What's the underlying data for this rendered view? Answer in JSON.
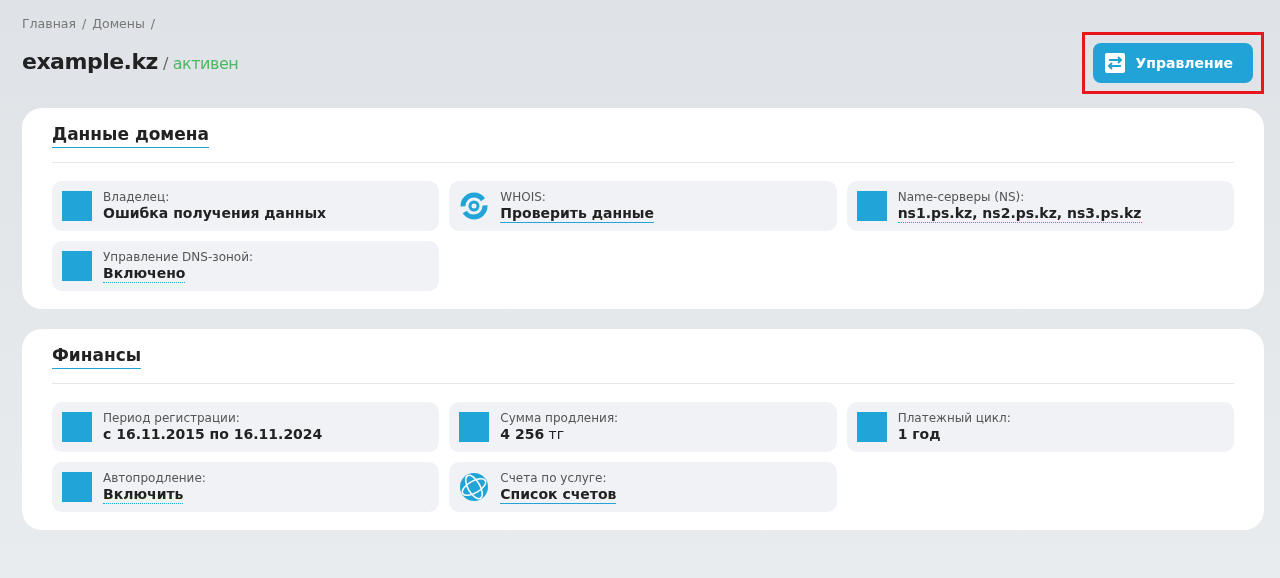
{
  "breadcrumbs": [
    {
      "label": "Главная",
      "separator": "/"
    },
    {
      "label": "Домены",
      "separator": "/"
    }
  ],
  "title": {
    "domain": "example.kz",
    "separator": "/",
    "status": "активен"
  },
  "manage_button": {
    "label": "Управление",
    "highlighted": true
  },
  "sections": [
    {
      "title": "Данные домена",
      "items": [
        {
          "kind": "field",
          "label": "Владелец:",
          "value": "Ошибка получения данных"
        },
        {
          "kind": "whois",
          "label": "WHOIS:",
          "value": "Проверить данные"
        },
        {
          "kind": "setting",
          "label": "Name-серверы (NS):",
          "value": "ns1.ps.kz, ns2.ps.kz, ns3.ps.kz"
        },
        {
          "kind": "setting",
          "label": "Управление DNS-зоной:",
          "value": "Включено"
        }
      ]
    },
    {
      "title": "Финансы",
      "items": [
        {
          "kind": "field",
          "label": "Период регистрации:",
          "value": "с 16.11.2015 по 16.11.2024"
        },
        {
          "kind": "field",
          "label": "Сумма продления:",
          "value": "**4 256** тг"
        },
        {
          "kind": "field",
          "label": "Платежный цикл:",
          "value": "1 год"
        },
        {
          "kind": "setting",
          "label": "Автопродление:",
          "value": "Включить"
        },
        {
          "kind": "invoices",
          "label": "Счета по услуге:",
          "value": "Список счетов"
        }
      ]
    }
  ]
}
